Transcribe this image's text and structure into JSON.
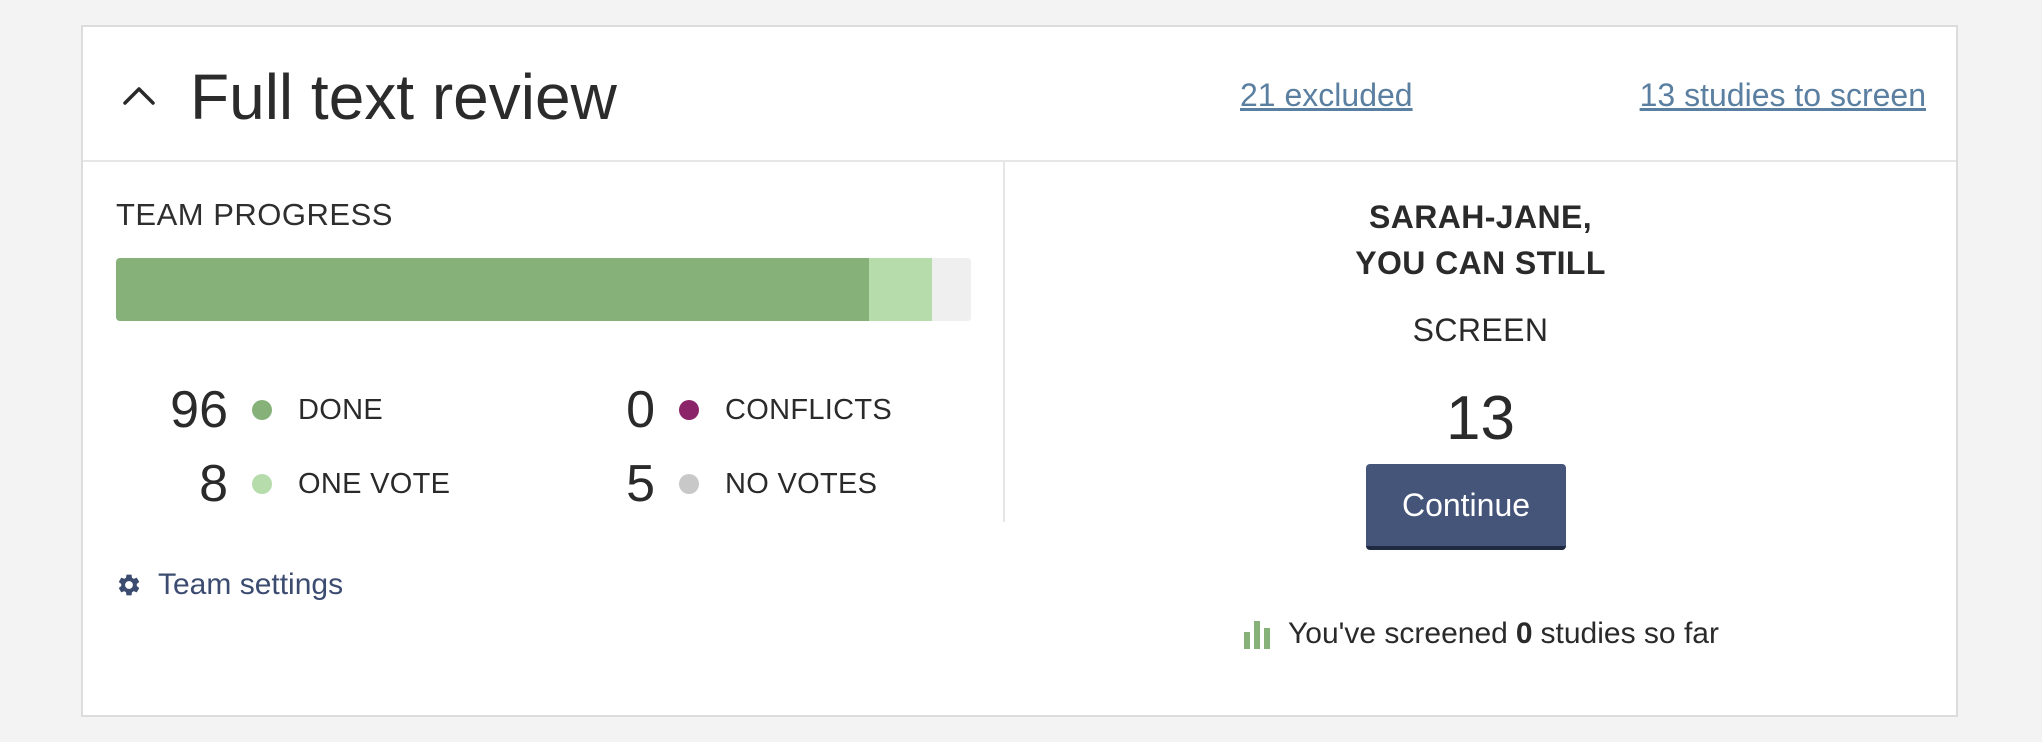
{
  "header": {
    "title": "Full text review",
    "excluded_link": "21 excluded",
    "to_screen_link": "13 studies to screen",
    "chevron_icon": "chevron-up-icon"
  },
  "team_progress": {
    "title": "TEAM PROGRESS",
    "colors": {
      "done": "#86b27a",
      "one_vote": "#b6dcab",
      "conflicts": "#8b2468",
      "no_votes": "#c8c8c8"
    },
    "stats": {
      "done": {
        "value": "96",
        "label": "DONE"
      },
      "one_vote": {
        "value": "8",
        "label": "ONE VOTE"
      },
      "conflicts": {
        "value": "0",
        "label": "CONFLICTS"
      },
      "no_votes": {
        "value": "5",
        "label": "NO VOTES"
      }
    },
    "bar_counts": {
      "done": 96,
      "one_vote": 8,
      "conflicts": 0,
      "no_votes": 5
    }
  },
  "team_settings": {
    "label": "Team settings",
    "icon": "gear-icon",
    "color": "#3c4c70"
  },
  "screening": {
    "greeting_line1": "SARAH-JANE,",
    "greeting_line2": "YOU CAN STILL",
    "screen_label": "SCREEN",
    "remaining": "13",
    "continue_label": "Continue",
    "button_color": "#45557a",
    "screened_prefix": "You've screened",
    "screened_count": "0",
    "screened_suffix": "studies so far",
    "stats_icon": "bar-chart-icon"
  }
}
